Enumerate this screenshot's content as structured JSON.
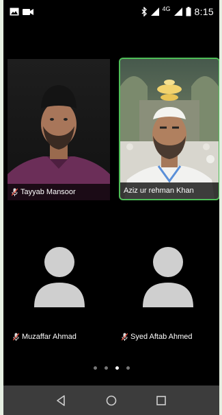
{
  "status_bar": {
    "time": "8:15",
    "network": "4G",
    "icons": [
      "image-icon",
      "video-icon",
      "bluetooth-icon",
      "signal-icon",
      "signal-icon-2",
      "battery-icon"
    ]
  },
  "participants": [
    {
      "name": "Tayyab Mansoor",
      "muted": true,
      "video": true,
      "active_speaker": false
    },
    {
      "name": "Aziz ur rehman Khan",
      "muted": false,
      "video": true,
      "active_speaker": true
    },
    {
      "name": "Muzaffar Ahmad",
      "muted": true,
      "video": false,
      "active_speaker": false
    },
    {
      "name": "Syed Aftab Ahmed",
      "muted": true,
      "video": false,
      "active_speaker": false
    }
  ],
  "pager": {
    "count": 4,
    "active_index": 2
  },
  "nav": {
    "buttons": [
      "back-icon",
      "home-icon",
      "recents-icon"
    ]
  },
  "colors": {
    "active_border": "#4fbf58",
    "background": "#000000",
    "navbar": "#3c3c3c"
  }
}
